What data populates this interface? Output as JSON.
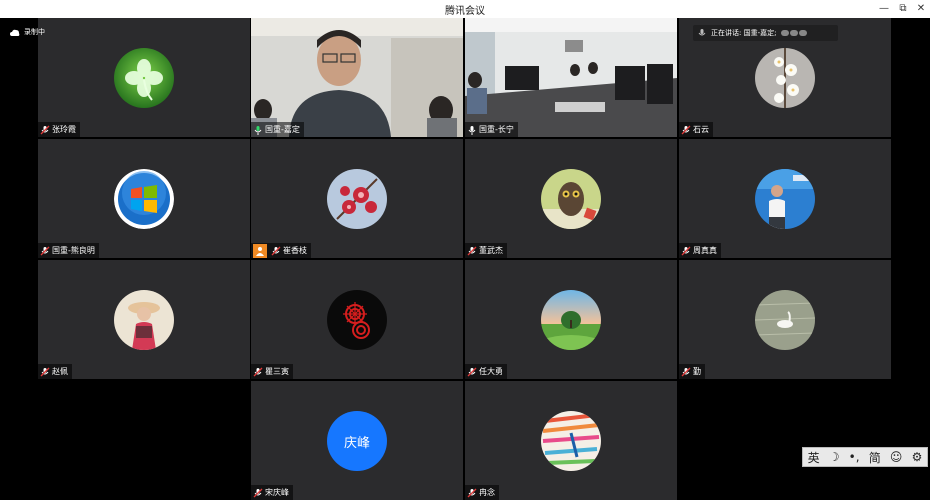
{
  "window": {
    "title": "腾讯会议",
    "minimize": "—",
    "restore": "⧉",
    "close": "✕"
  },
  "status": {
    "recording_label": "录制中",
    "speaking_label": "正在讲话: 国重-嘉定;"
  },
  "participants": [
    {
      "name": "张玲霞",
      "avatar": "clover-avatar"
    },
    {
      "name": "国重-嘉定",
      "avatar": "video-feed"
    },
    {
      "name": "国重-长宁",
      "avatar": "video-feed"
    },
    {
      "name": "石云",
      "avatar": "blossom-avatar"
    },
    {
      "name": "国重-熊良明",
      "avatar": "windows-logo-avatar"
    },
    {
      "name": "崔香枝",
      "avatar": "red-flower-avatar"
    },
    {
      "name": "董武杰",
      "avatar": "owl-avatar"
    },
    {
      "name": "周真真",
      "avatar": "person-avatar"
    },
    {
      "name": "赵佩",
      "avatar": "girl-avatar"
    },
    {
      "name": "瞿三寅",
      "avatar": "dark-red-flower-avatar"
    },
    {
      "name": "任大勇",
      "avatar": "landscape-avatar"
    },
    {
      "name": "勤",
      "avatar": "swan-avatar"
    },
    {
      "name": "宋庆峰",
      "avatar": "text-avatar",
      "initials": "庆峰"
    },
    {
      "name": "冉念",
      "avatar": "crayon-avatar"
    }
  ],
  "ime": {
    "lang": "英",
    "moon": "☽",
    "punct": "•,",
    "simplified": "简",
    "emoji": "☺",
    "settings": "⚙"
  },
  "colors": {
    "tile_bg": "#2b2b2d",
    "speaking_border": "#2fd86a",
    "text_avatar_bg": "#1677ff",
    "host_badge": "#f08a24"
  }
}
